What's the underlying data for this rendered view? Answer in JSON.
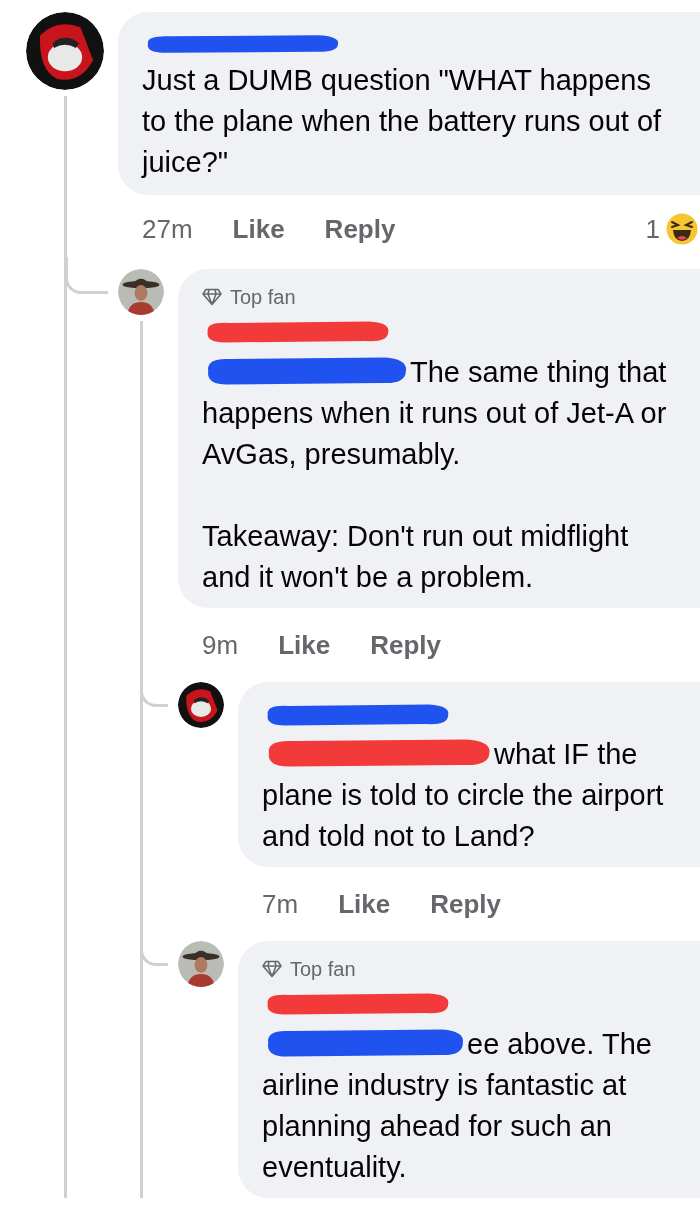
{
  "comments": [
    {
      "avatar": {
        "kind": "emblem"
      },
      "name_mark": {
        "color": "#1f52ee"
      },
      "paragraphs": [
        {
          "text": "Just a DUMB question \"WHAT happens to the plane when the battery runs out of juice?\""
        }
      ],
      "time": "27m",
      "like": "Like",
      "reply": "Reply",
      "reaction": {
        "count": "1"
      },
      "replies": [
        {
          "avatar": {
            "kind": "photo"
          },
          "badge": "Top fan",
          "name_mark": {
            "color": "#f23a3a"
          },
          "inline_mark": {
            "color": "#1f52ee"
          },
          "paragraphs": [
            {
              "text": "The same thing that happens when it runs out of Jet-A or AvGas, presumably."
            },
            {
              "text": "Takeaway: Don't run out midflight and it won't be a problem."
            }
          ],
          "time": "9m",
          "like": "Like",
          "reply": "Reply",
          "replies": [
            {
              "avatar": {
                "kind": "emblem"
              },
              "name_mark": {
                "color": "#1f52ee"
              },
              "inline_mark": {
                "color": "#f23a3a"
              },
              "paragraphs": [
                {
                  "text": "what IF the plane is told to circle the airport and told not to Land?"
                }
              ],
              "time": "7m",
              "like": "Like",
              "reply": "Reply"
            },
            {
              "avatar": {
                "kind": "photo"
              },
              "badge": "Top fan",
              "name_mark": {
                "color": "#f23a3a"
              },
              "inline_mark": {
                "color": "#1f52ee"
              },
              "paragraphs": [
                {
                  "text": "ee above. The airline industry is fantastic at planning ahead for such an eventuality."
                }
              ]
            }
          ]
        }
      ]
    }
  ]
}
